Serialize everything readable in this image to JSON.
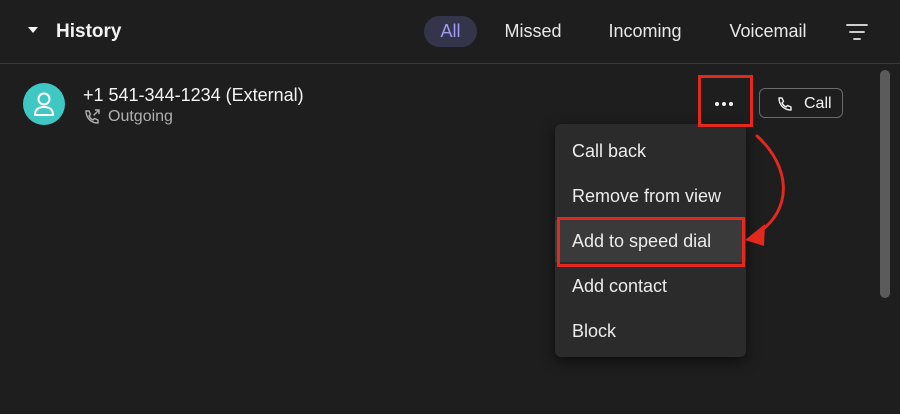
{
  "header": {
    "title": "History",
    "tabs": [
      "All",
      "Missed",
      "Incoming",
      "Voicemail"
    ],
    "active_tab": "All"
  },
  "entry": {
    "caller": "+1 541-344-1234 (External)",
    "call_type": "Outgoing",
    "call_button_label": "Call"
  },
  "menu": {
    "items": [
      "Call back",
      "Remove from view",
      "Add to speed dial",
      "Add contact",
      "Block"
    ],
    "hovered_item": "Add to speed dial"
  },
  "colors": {
    "avatar": "#3fc7c4",
    "active_tab_text": "#9d9cf2",
    "annotation": "#e3281e"
  }
}
